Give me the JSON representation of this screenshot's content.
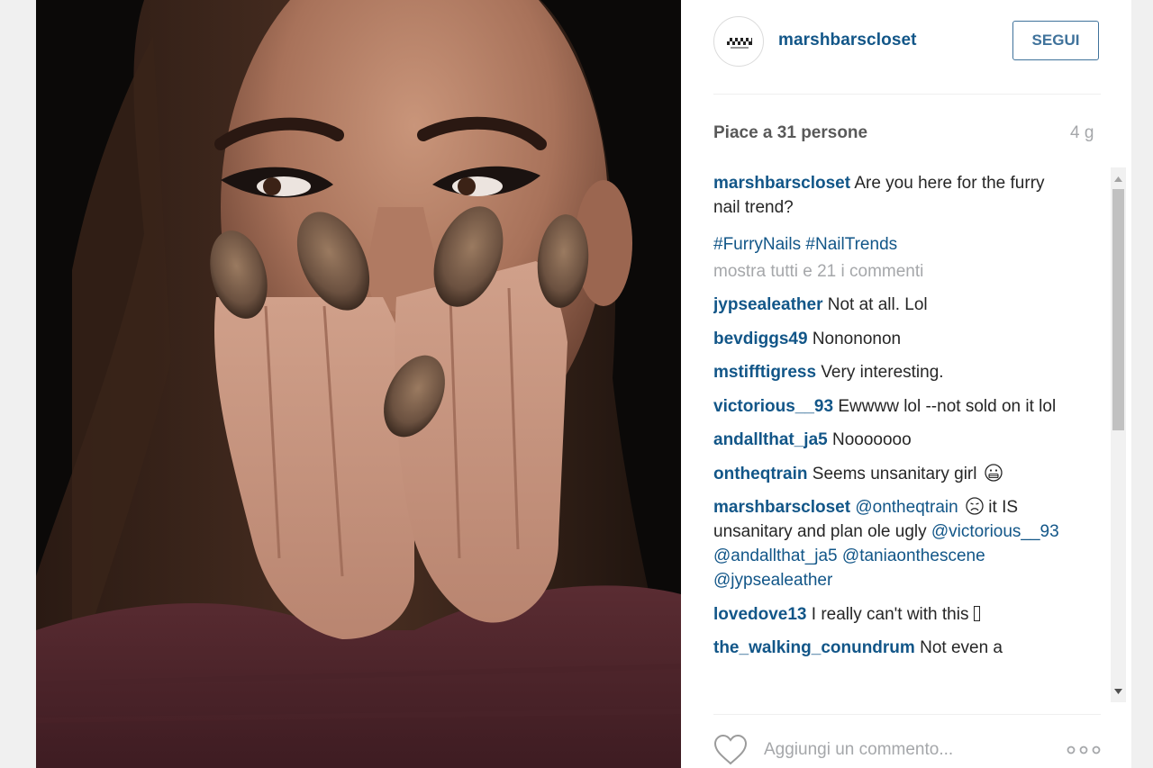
{
  "post": {
    "author": "marshbarscloset",
    "follow_label": "SEGUI",
    "likes_text": "Piace a 31 persone",
    "time_ago": "4 g",
    "caption": {
      "user": "marshbarscloset",
      "text": "Are you here for the furry nail trend?"
    },
    "hashtags": "#FurryNails #NailTrends",
    "load_more": "mostra tutti e 21 i commenti",
    "comments": [
      {
        "user": "jypsealeather",
        "text": "Not at all. Lol"
      },
      {
        "user": "bevdiggs49",
        "text": "Nonononon"
      },
      {
        "user": "mstifftigress",
        "text": "Very interesting."
      },
      {
        "user": "victorious__93",
        "text": "Ewwww lol --not sold on it lol"
      },
      {
        "user": "andallthat_ja5",
        "text": "Nooooooo"
      },
      {
        "user": "ontheqtrain",
        "text": "Seems unsanitary girl",
        "emoji": "grimace-emoji"
      },
      {
        "user": "marshbarscloset",
        "mention_1": "@ontheqtrain",
        "emoji": "frown-emoji",
        "text": "it IS unsanitary and plan ole ugly",
        "mentions_rest": [
          "@victorious__93",
          "@andallthat_ja5",
          "@taniaonthescene",
          "@jypsealeather"
        ]
      },
      {
        "user": "lovedove13",
        "text": "I really can't with this",
        "glyph": "missing-glyph-box"
      },
      {
        "user": "the_walking_conundrum",
        "text": "Not even a"
      }
    ],
    "comment_placeholder": "Aggiungi un commento...",
    "icons": {
      "like": "heart-outline-icon",
      "more": "ellipsis-icon",
      "scroll_up": "triangle-up-icon",
      "scroll_down": "triangle-down-icon"
    }
  },
  "colors": {
    "username": "#125688",
    "follow": "#3f729b",
    "muted": "#a5a7aa",
    "text": "#262626"
  }
}
